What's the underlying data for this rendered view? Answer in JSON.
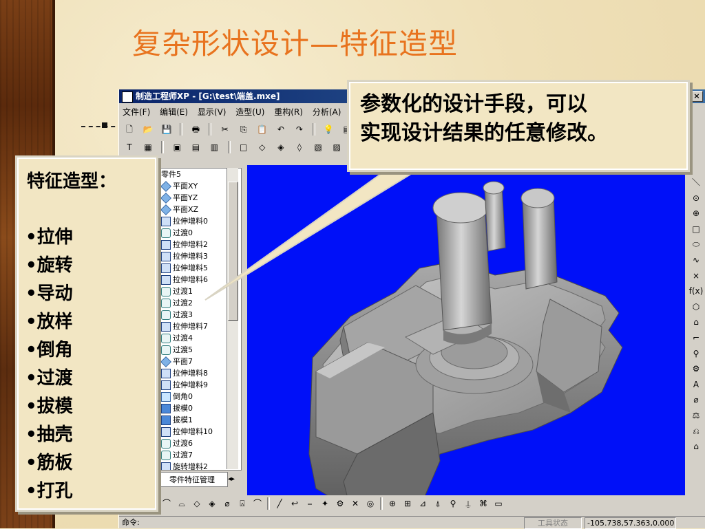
{
  "slide": {
    "title": "复杂形状设计—特征造型"
  },
  "window": {
    "title": "制造工程师XP - [G:\\test\\端盖.mxe]",
    "close_label": "×"
  },
  "menu": [
    "文件(F)",
    "编辑(E)",
    "显示(V)",
    "造型(U)",
    "重构(R)",
    "分析(A)"
  ],
  "toolbar1": [
    "🗋",
    "📂",
    "💾",
    "🖶",
    "✂",
    "⎘",
    "📋",
    "↶",
    "↷",
    "💡",
    "▤"
  ],
  "toolbar2": [
    "T",
    "▦",
    "▣",
    "▤",
    "▥",
    "□",
    "◇",
    "◈",
    "◊",
    "▧",
    "▨"
  ],
  "feature_tree": {
    "root": "零件5",
    "items": [
      {
        "label": "平面XY",
        "icon": "plane"
      },
      {
        "label": "平面YZ",
        "icon": "plane"
      },
      {
        "label": "平面XZ",
        "icon": "plane"
      },
      {
        "label": "拉伸增料0",
        "icon": "extrude"
      },
      {
        "label": "过渡0",
        "icon": "fillet"
      },
      {
        "label": "拉伸增料2",
        "icon": "extrude"
      },
      {
        "label": "拉伸增料3",
        "icon": "extrude"
      },
      {
        "label": "拉伸增料5",
        "icon": "extrude"
      },
      {
        "label": "拉伸增料6",
        "icon": "extrude"
      },
      {
        "label": "过渡1",
        "icon": "fillet"
      },
      {
        "label": "过渡2",
        "icon": "fillet"
      },
      {
        "label": "过渡3",
        "icon": "fillet"
      },
      {
        "label": "拉伸增料7",
        "icon": "extrude"
      },
      {
        "label": "过渡4",
        "icon": "fillet"
      },
      {
        "label": "过渡5",
        "icon": "fillet"
      },
      {
        "label": "平面7",
        "icon": "plane"
      },
      {
        "label": "拉伸增料8",
        "icon": "extrude"
      },
      {
        "label": "拉伸增料9",
        "icon": "extrude"
      },
      {
        "label": "倒角0",
        "icon": "chamfer"
      },
      {
        "label": "拔模0",
        "icon": "draft"
      },
      {
        "label": "拔模1",
        "icon": "draft"
      },
      {
        "label": "拉伸增料10",
        "icon": "extrude"
      },
      {
        "label": "过渡6",
        "icon": "fillet"
      },
      {
        "label": "过渡7",
        "icon": "fillet"
      },
      {
        "label": "旋转增料2",
        "icon": "extrude"
      }
    ],
    "tab_label": "零件特征管理"
  },
  "right_tools": [
    "＼",
    "⊙",
    "⊕",
    "□",
    "⬭",
    "∿",
    "×",
    "f(x)",
    "⬡",
    "⌂",
    "⌐",
    "⚲",
    "⚙",
    "A",
    "⌀",
    "⚖",
    "⎌",
    "⌂"
  ],
  "bottom_tools": [
    "⌒",
    "⌓",
    "◇",
    "◈",
    "⌀",
    "⍓",
    "⌒",
    "╱",
    "↩",
    "⎯",
    "✦",
    "⚙",
    "✕",
    "◎",
    "⊕",
    "⊞",
    "⊿",
    "⍋",
    "⚲",
    "⍊",
    "⌘",
    "▭"
  ],
  "statusbar": {
    "command_label": "命令:",
    "tool_state": "工具状态",
    "coordinates": "-105.738,57.363,0.000"
  },
  "callout_top": {
    "line1": "参数化的设计手段，可以",
    "line2": "实现设计结果的任意修改。"
  },
  "callout_left": {
    "title": "特征造型：",
    "items": [
      "•拉伸",
      "•旋转",
      "•导动",
      "•放样",
      "•倒角",
      "•过渡",
      "•拔模",
      "•抽壳",
      "•筋板",
      "•打孔"
    ]
  },
  "colors": {
    "title": "#e8731e",
    "viewport": "#0010f8",
    "part": "#8e8e8e",
    "titlebar": "#0a246a"
  }
}
